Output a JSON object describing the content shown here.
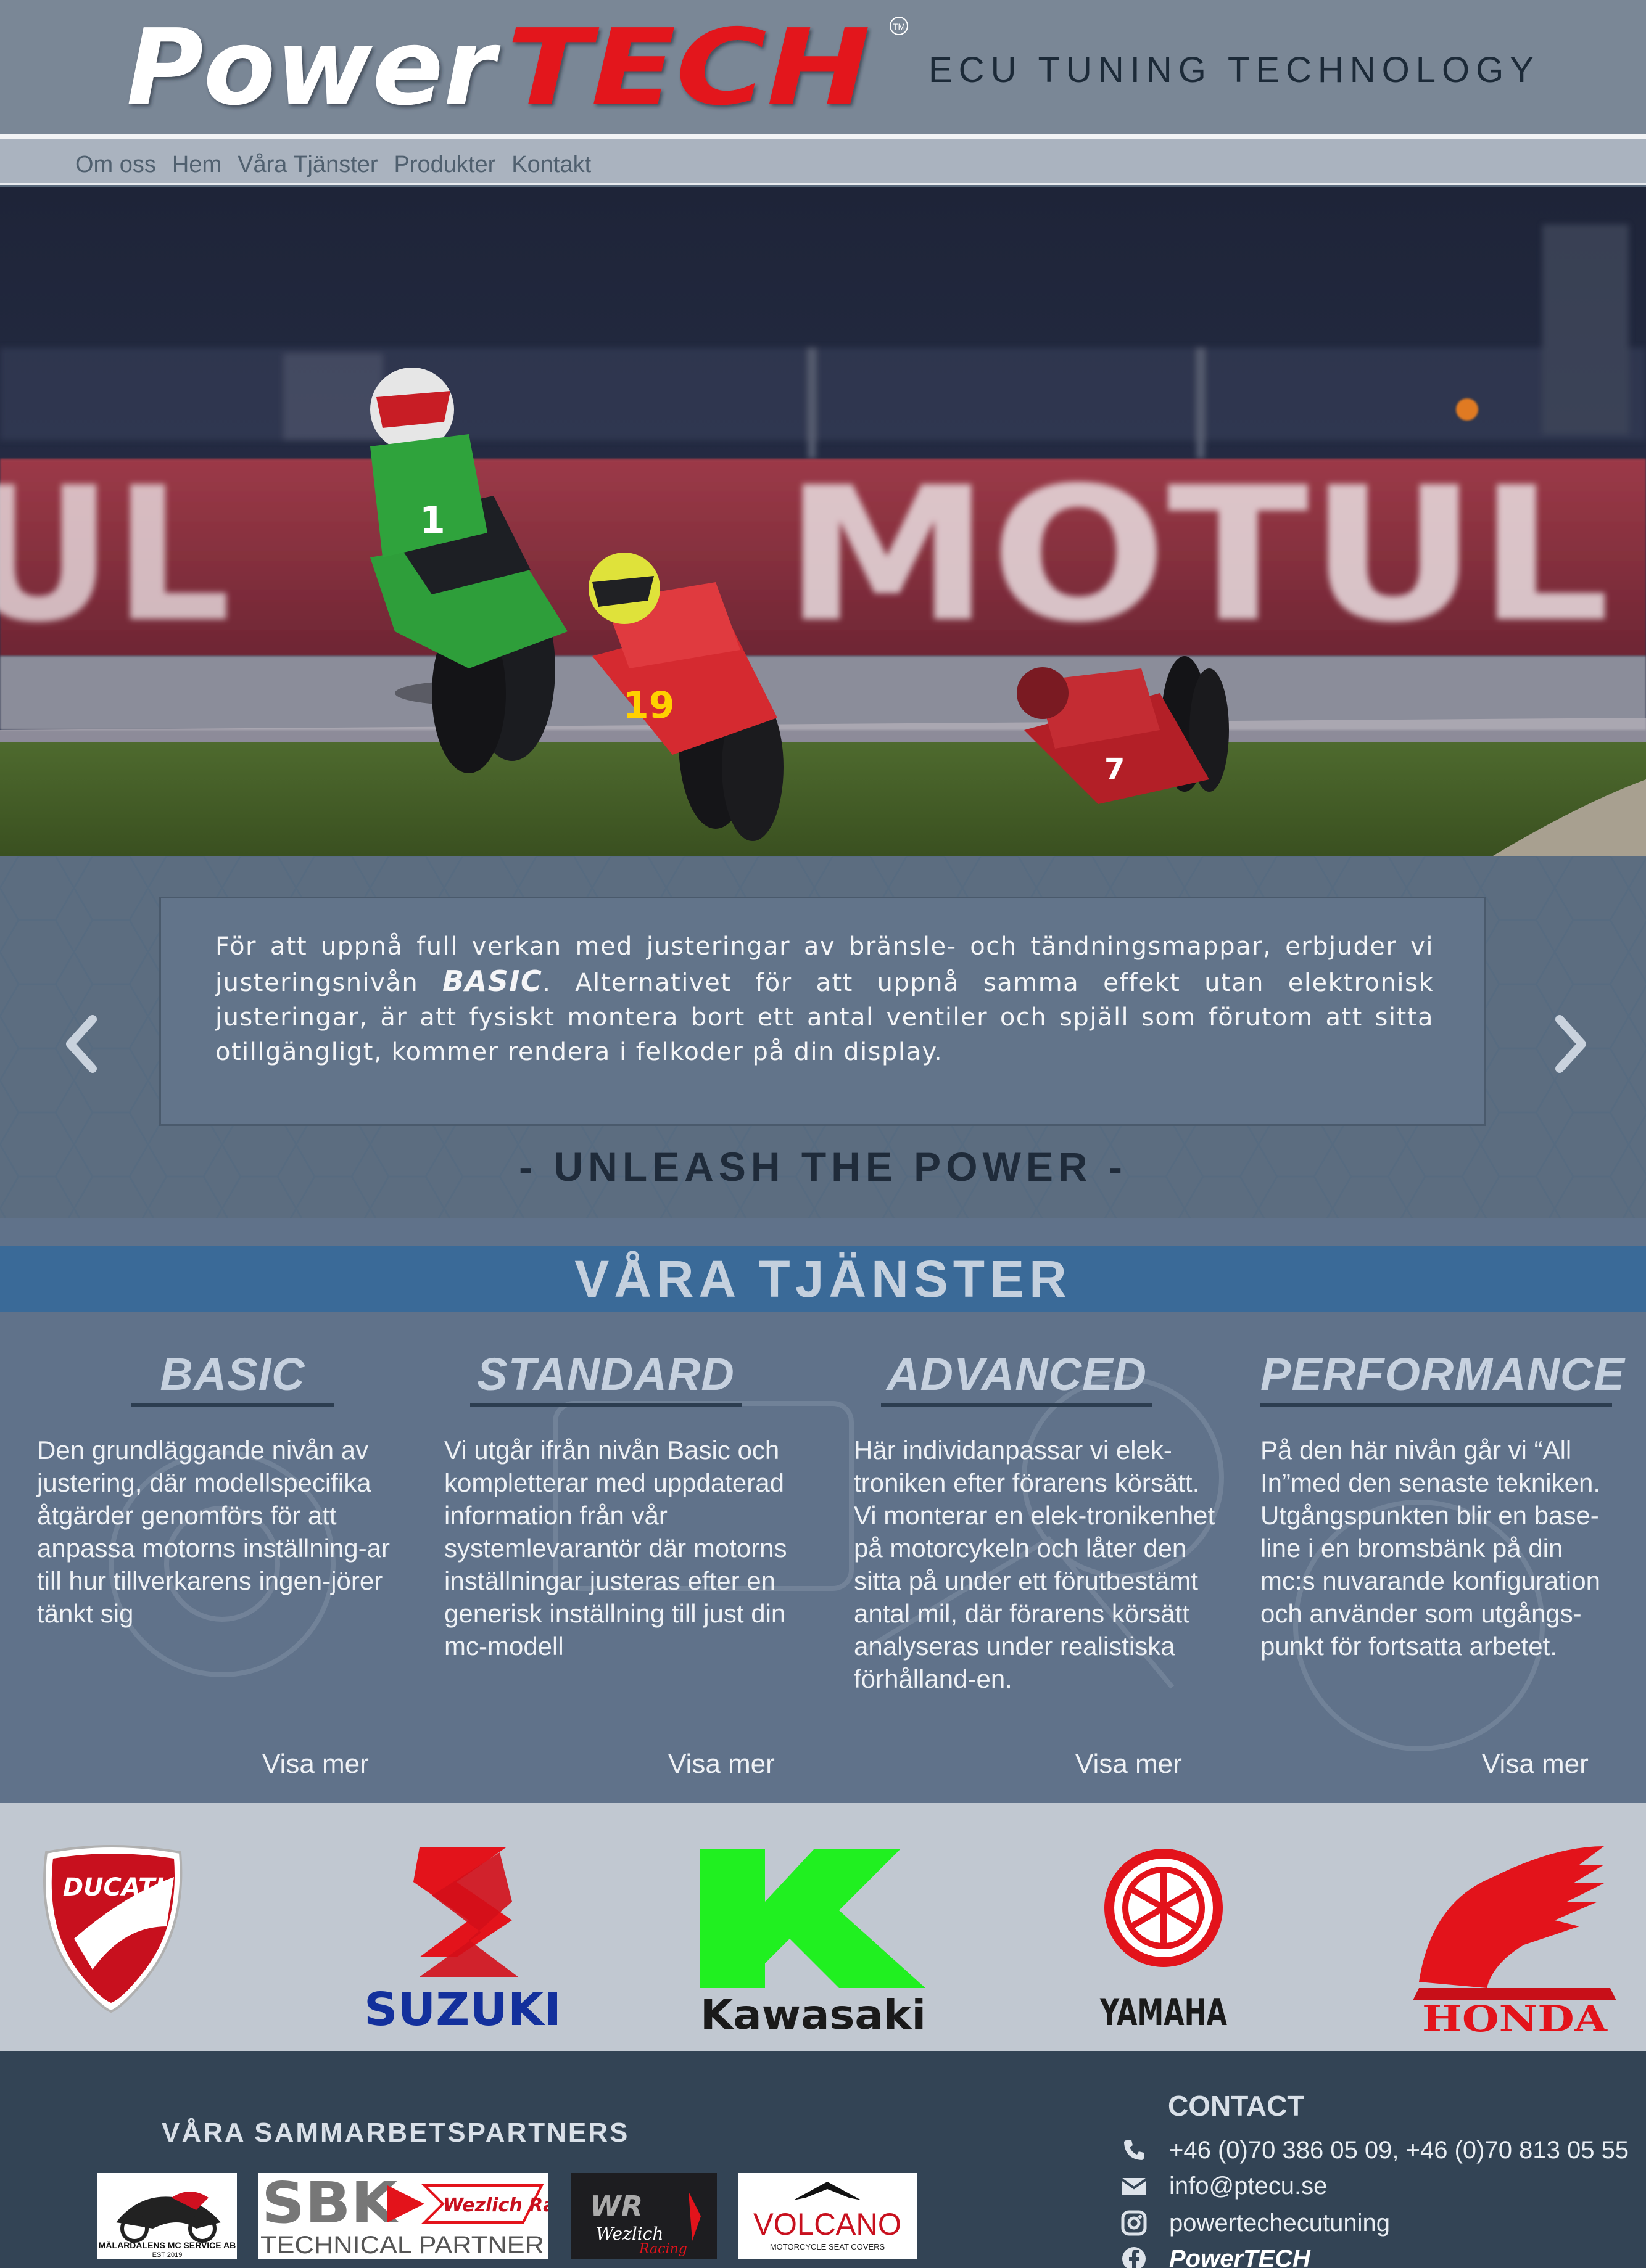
{
  "header": {
    "logo_power": "Power",
    "logo_tech": "TECH",
    "logo_tm": "TM",
    "tagline": "ECU TUNING TECHNOLOGY"
  },
  "nav": [
    "Om oss",
    "Hem",
    "Våra Tjänster",
    "Produkter",
    "Kontakt"
  ],
  "hero": {
    "banner_text": "MOTUL",
    "rider_numbers": [
      "1",
      "19",
      "7"
    ]
  },
  "slider": {
    "text_before": "För att uppnå full verkan med justeringar av bränsle- och tändningsmappar, erbjuder vi justeringsnivån ",
    "text_bold": "BASIC",
    "text_after": ". Alternativet för att uppnå samma effekt utan elektronisk justeringar, är att fysiskt montera bort ett antal ventiler och spjäll som förutom att sitta otillgängligt, kommer rendera i felkoder på din display.",
    "slogan": "- UNLEASH THE POWER -"
  },
  "services": {
    "title": "VÅRA TJÄNSTER",
    "items": [
      {
        "title": "BASIC",
        "text": "Den grundläggande nivån av justering, där modellspecifika åtgärder genomförs för att anpassa motorns inställning-ar till hur tillverkarens ingen-jörer tänkt sig",
        "more": "Visa mer"
      },
      {
        "title": "STANDARD",
        "text": "Vi utgår ifrån nivån Basic och kompletterar med uppdaterad information från vår systemlevarantör där motorns inställningar justeras efter en generisk inställning till just din mc-modell",
        "more": "Visa mer"
      },
      {
        "title": "ADVANCED",
        "text": "Här individanpassar vi elek-troniken efter förarens körsätt. Vi monterar en elek-tronikenhet på motorcykeln och låter den sitta på under ett förutbestämt antal mil, där förarens körsätt analyseras under realistiska förhålland-en.",
        "more": "Visa mer"
      },
      {
        "title": "PERFORMANCE",
        "text": "På den här nivån går vi “All In”med den senaste tekniken. Utgångspunkten blir en base-line i en bromsbänk på din mc:s nuvarande konfiguration och använder som utgångs-punkt för fortsatta arbetet.",
        "more": "Visa mer"
      }
    ]
  },
  "brands": [
    {
      "name": "DUCATI",
      "icon": "ducati-logo"
    },
    {
      "name": "SUZUKI",
      "icon": "suzuki-logo"
    },
    {
      "name": "Kawasaki",
      "icon": "kawasaki-logo"
    },
    {
      "name": "YAMAHA",
      "icon": "yamaha-logo"
    },
    {
      "name": "HONDA",
      "icon": "honda-logo"
    }
  ],
  "footer": {
    "partners_title": "VÅRA SAMMARBETSPARTNERS",
    "partners": [
      {
        "line1": "MÄLARDALENS MC SERVICE AB",
        "line2": "EST 2019"
      },
      {
        "line1": "SBK",
        "line2": "TECHNICAL PARTNER",
        "line3": "Wezlich Racing"
      },
      {
        "line1": "Wezlich",
        "line2": "Racing"
      },
      {
        "line1": "VOLCANO",
        "line2": "MOTORCYCLE SEAT COVERS"
      }
    ],
    "contact_title": "CONTACT",
    "phone": "+46 (0)70 386 05 09, +46 (0)70 813 05 55",
    "email": "info@ptecu.se",
    "instagram": "powertechecutuning",
    "facebook": "PowerTECH"
  },
  "colors": {
    "header_bg": "#7a8796",
    "logo_white": "#ffffff",
    "logo_red": "#e3131b",
    "services_bar": "#3a6a98",
    "footer_bg": "#334455"
  }
}
